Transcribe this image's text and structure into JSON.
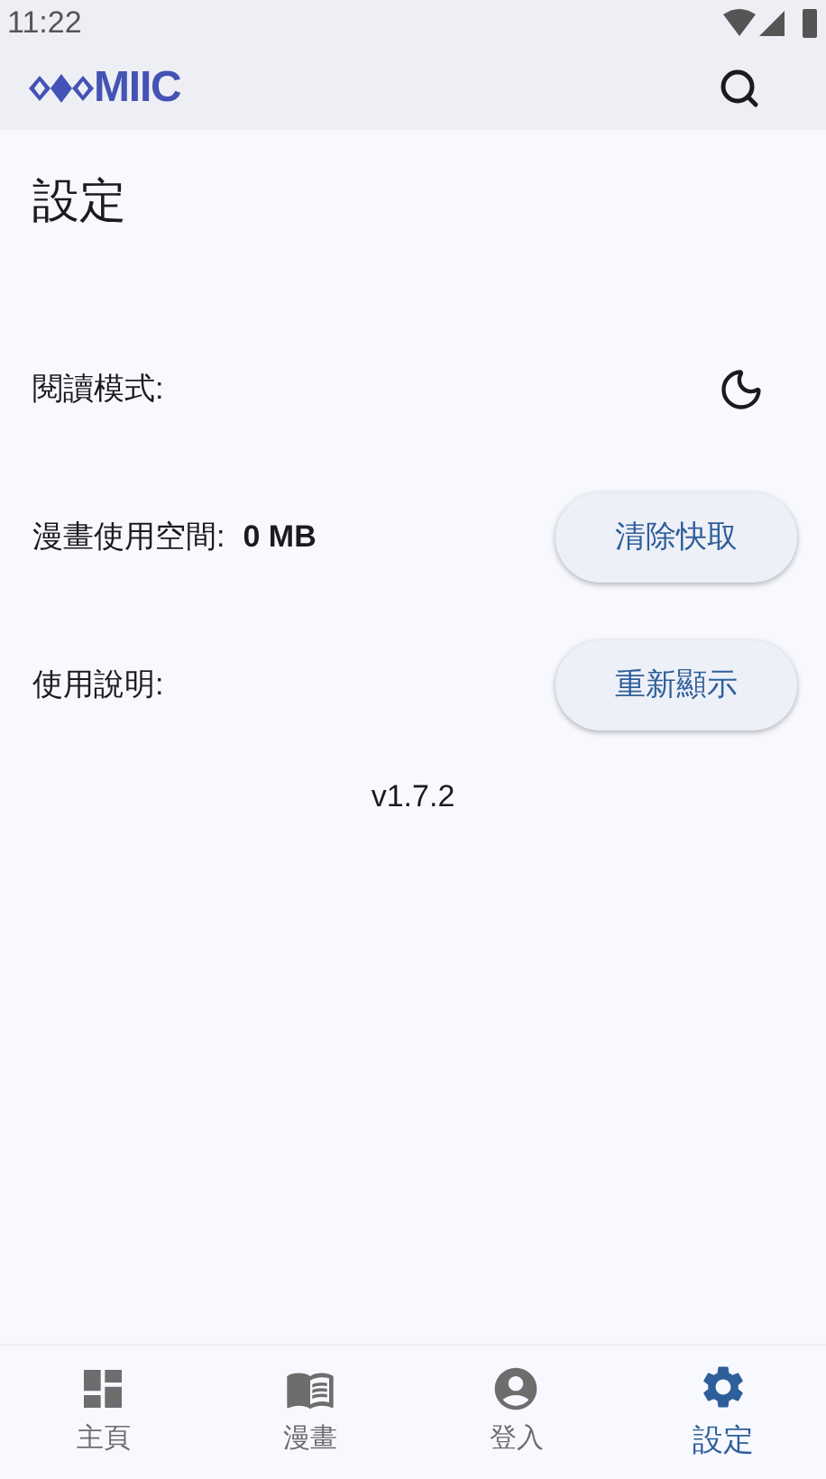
{
  "status_bar": {
    "time": "11:22"
  },
  "app_bar": {
    "logo_text": "MIIC"
  },
  "page": {
    "title": "設定"
  },
  "settings": [
    {
      "kind": "toggle",
      "label": "閱讀模式:",
      "on": true
    },
    {
      "kind": "button",
      "label": "漫畫使用空間:",
      "value": "0 MB",
      "button": "清除快取"
    },
    {
      "kind": "button",
      "label": "使用說明:",
      "button": "重新顯示"
    }
  ],
  "version": "v1.7.2",
  "bottom_nav": [
    {
      "kind": "home",
      "label": "主頁",
      "selected": false
    },
    {
      "kind": "book",
      "label": "漫畫",
      "selected": false
    },
    {
      "kind": "account",
      "label": "登入",
      "selected": false
    },
    {
      "kind": "settings",
      "label": "設定",
      "selected": true
    }
  ]
}
